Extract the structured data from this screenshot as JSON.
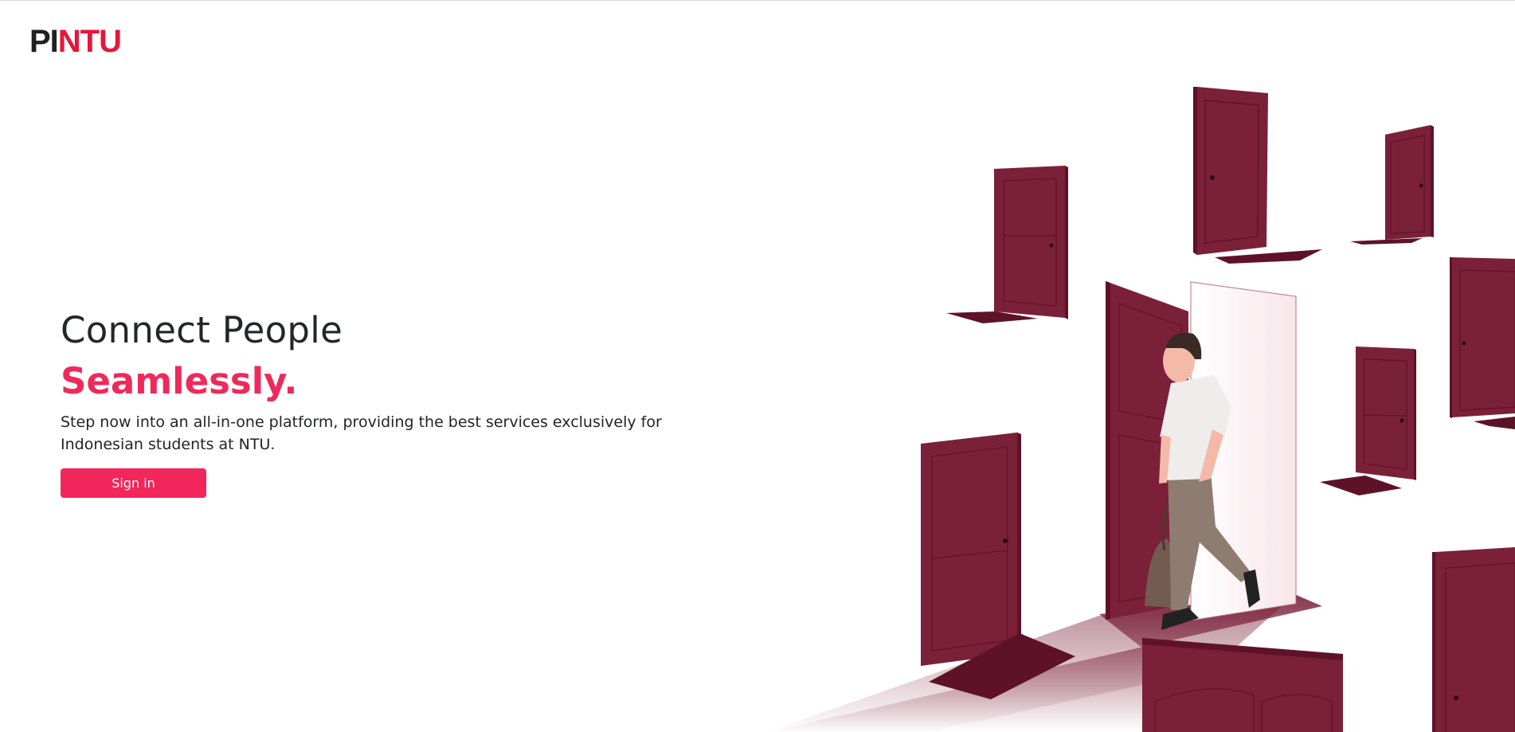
{
  "header": {
    "logo_part1": "PI",
    "logo_part2": "NTU"
  },
  "hero": {
    "title": "Connect People",
    "accent": "Seamlessly.",
    "description": "Step now into an all-in-one platform, providing the best services exclusively for Indonesian students at NTU.",
    "signin_label": "Sign in"
  },
  "colors": {
    "brand_red": "#e4173a",
    "button": "#f1265a",
    "door": "#7b2039",
    "door_dark": "#5e1228"
  },
  "illustration": {
    "subject": "person-walking-through-door-illustration"
  }
}
